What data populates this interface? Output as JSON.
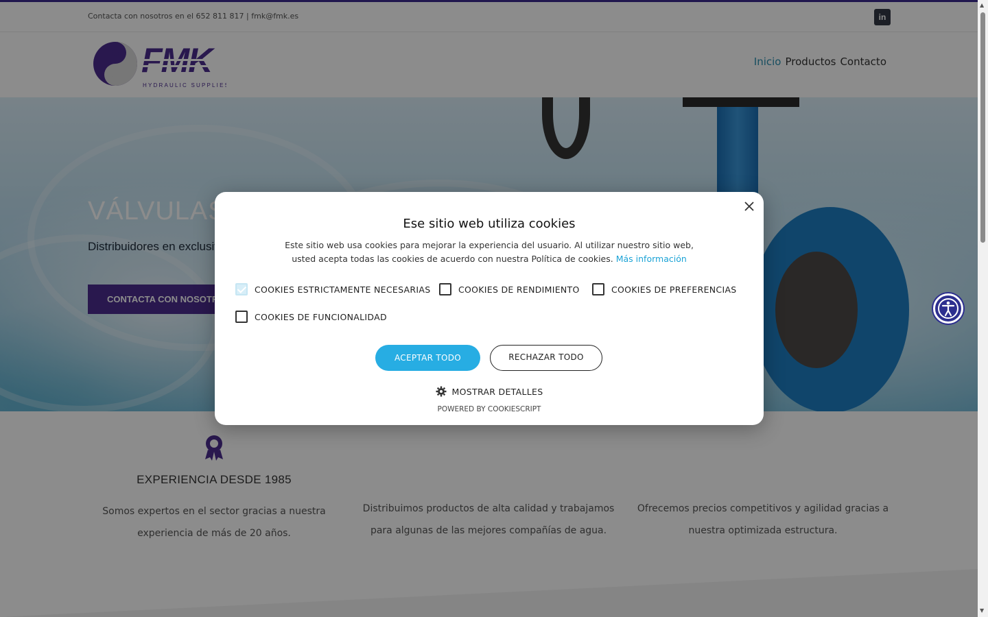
{
  "topbar": {
    "contact_text": "Contacta con nosotros en el 652 811 817  |  fmk@fmk.es",
    "linkedin_label": "in"
  },
  "header": {
    "logo_text": "FMK",
    "logo_tagline": "HYDRAULIC SUPPLIES",
    "nav": [
      {
        "label": "Inicio",
        "active": true
      },
      {
        "label": "Productos",
        "active": false
      },
      {
        "label": "Contacto",
        "active": false
      }
    ]
  },
  "hero": {
    "title": "VÁLVULAS Y",
    "subtitle": "Distribuidores en exclusiva",
    "button": "CONTACTA CON NOSOTRO"
  },
  "features": [
    {
      "title": "EXPERIENCIA DESDE 1985",
      "text_line1": "Somos expertos en el sector gracias a nuestra",
      "text_line2": "experiencia de más de 20 años.",
      "icon": "award-ribbon-icon"
    },
    {
      "title": "",
      "text_line1": "Distribuimos productos de alta calidad y trabajamos",
      "text_line2": "para algunas de las mejores compañías de agua.",
      "icon": ""
    },
    {
      "title": "",
      "text_line1": "Ofrecemos precios competitivos y agilidad gracias a",
      "text_line2": "nuestra optimizada estructura.",
      "icon": ""
    }
  ],
  "cookie_modal": {
    "title": "Ese sitio web utiliza cookies",
    "description": "Este sitio web usa cookies para mejorar la experiencia del usuario. Al utilizar nuestro sitio web, usted acepta todas las cookies de acuerdo con nuestra Política de cookies.",
    "more_info": "Más información",
    "options": [
      {
        "label": "COOKIES ESTRICTAMENTE NECESARIAS",
        "checked": true
      },
      {
        "label": "COOKIES DE RENDIMIENTO",
        "checked": false
      },
      {
        "label": "COOKIES DE PREFERENCIAS",
        "checked": false
      },
      {
        "label": "COOKIES DE FUNCIONALIDAD",
        "checked": false
      }
    ],
    "accept_all": "ACEPTAR TODO",
    "reject_all": "RECHAZAR TODO",
    "show_details": "MOSTRAR DETALLES",
    "powered_by": "POWERED BY COOKIESCRIPT"
  },
  "colors": {
    "brand_purple": "#4b2d8f",
    "nav_active": "#2a8fb0",
    "accept_blue": "#27ade3",
    "link_blue": "#1ca3d6"
  }
}
